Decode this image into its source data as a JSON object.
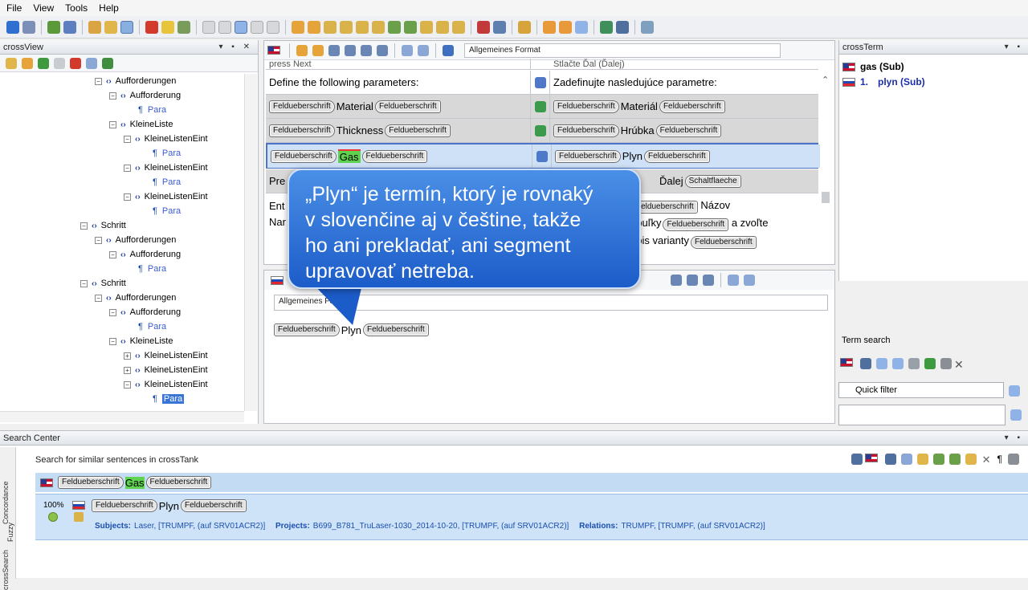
{
  "menubar": {
    "items": [
      "File",
      "View",
      "Tools",
      "Help"
    ]
  },
  "crossview": {
    "title": "crossView",
    "tree": [
      {
        "label": "Aufforderungen",
        "depth": 1,
        "kind": "tag",
        "tog": "⊟"
      },
      {
        "label": "Aufforderung",
        "depth": 2,
        "kind": "tag",
        "tog": "⊟"
      },
      {
        "label": "Para",
        "depth": 3,
        "kind": "para"
      },
      {
        "label": "KleineListe",
        "depth": 2,
        "kind": "tag",
        "tog": "⊟"
      },
      {
        "label": "KleineListenEint",
        "depth": 3,
        "kind": "tag",
        "tog": "⊟"
      },
      {
        "label": "Para",
        "depth": 4,
        "kind": "para"
      },
      {
        "label": "KleineListenEint",
        "depth": 3,
        "kind": "tag",
        "tog": "⊟"
      },
      {
        "label": "Para",
        "depth": 4,
        "kind": "para"
      },
      {
        "label": "KleineListenEint",
        "depth": 3,
        "kind": "tag",
        "tog": "⊟"
      },
      {
        "label": "Para",
        "depth": 4,
        "kind": "para"
      },
      {
        "label": "Schritt",
        "depth": 0,
        "kind": "tag",
        "tog": "⊟"
      },
      {
        "label": "Aufforderungen",
        "depth": 1,
        "kind": "tag",
        "tog": "⊟"
      },
      {
        "label": "Aufforderung",
        "depth": 2,
        "kind": "tag",
        "tog": "⊟"
      },
      {
        "label": "Para",
        "depth": 3,
        "kind": "para"
      },
      {
        "label": "Schritt",
        "depth": 0,
        "kind": "tag",
        "tog": "⊟"
      },
      {
        "label": "Aufforderungen",
        "depth": 1,
        "kind": "tag",
        "tog": "⊟"
      },
      {
        "label": "Aufforderung",
        "depth": 2,
        "kind": "tag",
        "tog": "⊟"
      },
      {
        "label": "Para",
        "depth": 3,
        "kind": "para"
      },
      {
        "label": "KleineListe",
        "depth": 2,
        "kind": "tag",
        "tog": "⊟"
      },
      {
        "label": "KleineListenEint",
        "depth": 3,
        "kind": "tag",
        "tog": "⊞"
      },
      {
        "label": "KleineListenEint",
        "depth": 3,
        "kind": "tag",
        "tog": "⊞"
      },
      {
        "label": "KleineListenEint",
        "depth": 3,
        "kind": "tag",
        "tog": "⊟"
      },
      {
        "label": "Para",
        "depth": 4,
        "kind": "para",
        "selected": true
      }
    ]
  },
  "editor": {
    "format_label": "Allgemeines Format",
    "partial_top": {
      "src": "press         Next",
      "tgt": "Stlačte         Ďal          (Ďalej)"
    },
    "rows": [
      {
        "src_text": "Define the following parameters:",
        "tgt_text": "Zadefinujte nasledujúce parametre:",
        "style": "white"
      },
      {
        "tag": "Feldueberschrift",
        "src_word": "Material",
        "tgt_word": "Materiál",
        "style": "grey"
      },
      {
        "tag": "Feldueberschrift",
        "src_word": "Thickness",
        "tgt_word": "Hrúbka",
        "style": "grey"
      },
      {
        "tag": "Feldueberschrift",
        "src_word": "Gas",
        "tgt_word": "Plyn",
        "style": "selected"
      }
    ],
    "row5": {
      "src": "Pre",
      "tgt_word": "Ďalej",
      "tgt_tag": "Schaltflaeche"
    },
    "row6": {
      "src_lines": [
        "Ent",
        "Nar"
      ],
      "tgt_word1": "Názov",
      "tgt_mid": "abuľky",
      "tgt_end": "a zvoľte",
      "tgt_word3": "opis varianty",
      "tag": "Feldueberschrift"
    }
  },
  "lower": {
    "format_label": "Allgemeines Fo",
    "tag": "Feldueberschrift",
    "word": "Plyn"
  },
  "crossterm": {
    "title": "crossTerm",
    "entries": [
      {
        "lang": "en",
        "text": "gas (Sub)"
      },
      {
        "lang": "sk",
        "num": "1.",
        "text": "plyn (Sub)"
      }
    ]
  },
  "termsearch": {
    "title": "Term search",
    "quick_filter": "Quick filter"
  },
  "searchcenter": {
    "title": "Search Center",
    "subtitle": "Search for similar sentences in crossTank",
    "side_tabs": [
      "Concordance",
      "Fuzzy",
      "crossSearch"
    ],
    "source": {
      "tag": "Feldueberschrift",
      "word": "Gas"
    },
    "hit": {
      "percent": "100%",
      "tag": "Feldueberschrift",
      "word": "Plyn",
      "subjects_label": "Subjects:",
      "subjects": "Laser, [TRUMPF, (auf SRV01ACR2)]",
      "projects_label": "Projects:",
      "projects": "B699_B781_TruLaser-1030_2014-10-20, [TRUMPF, (auf SRV01ACR2)]",
      "relations_label": "Relations:",
      "relations": "TRUMPF, [TRUMPF, (auf SRV01ACR2)]"
    }
  },
  "tooltip": {
    "lines": [
      "„Plyn“ je termín, ktorý je rovnaký",
      "v slovenčine aj v češtine, takže",
      "ho ani prekladať, ani segment",
      "upravovať netreba."
    ]
  },
  "colors": {
    "accent": "#3875d7",
    "tooltip": "#2b6fd8",
    "highlight": "#5fd34f"
  }
}
